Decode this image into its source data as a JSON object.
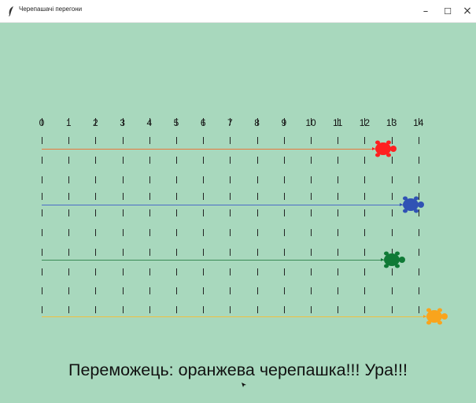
{
  "window": {
    "title": "Черепашачі перегони",
    "minimize_label": "–",
    "maximize_label": "☐",
    "close_label": "×"
  },
  "race": {
    "ticks": [
      "0",
      "1",
      "2",
      "3",
      "4",
      "5",
      "6",
      "7",
      "8",
      "9",
      "10",
      "11",
      "12",
      "13",
      "14"
    ],
    "turtles": [
      {
        "color": "#ff2020",
        "trail_color": "#e8793c",
        "icon": "turtle-icon",
        "position": 12.7
      },
      {
        "color": "#3052b4",
        "trail_color": "#4a6cc8",
        "icon": "turtle-icon",
        "position": 13.7
      },
      {
        "color": "#0f7a36",
        "trail_color": "#3a8a55",
        "icon": "turtle-icon",
        "position": 13.0
      },
      {
        "color": "#f9a41c",
        "trail_color": "#f0c040",
        "icon": "turtle-icon",
        "position": 14.6
      }
    ],
    "result_text": "Переможець: оранжева черепашка!!! Ура!!!"
  }
}
